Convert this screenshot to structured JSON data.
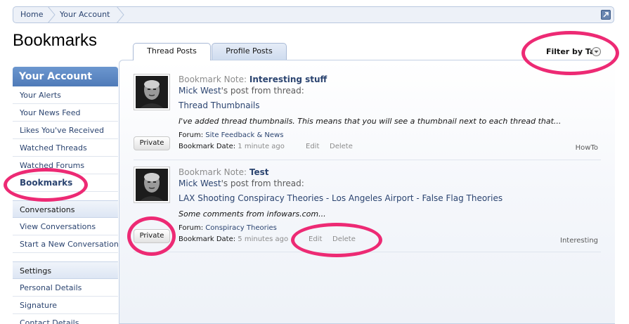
{
  "breadcrumb": {
    "home": "Home",
    "account": "Your Account"
  },
  "page": {
    "title": "Bookmarks"
  },
  "sidebar": {
    "heading": "Your Account",
    "items": [
      {
        "label": "Your Alerts"
      },
      {
        "label": "Your News Feed"
      },
      {
        "label": "Likes You've Received"
      },
      {
        "label": "Watched Threads"
      },
      {
        "label": "Watched Forums"
      },
      {
        "label": "Bookmarks"
      }
    ],
    "conversations": {
      "heading": "Conversations",
      "items": [
        {
          "label": "View Conversations"
        },
        {
          "label": "Start a New Conversation"
        }
      ]
    },
    "settings": {
      "heading": "Settings",
      "items": [
        {
          "label": "Personal Details"
        },
        {
          "label": "Signature"
        },
        {
          "label": "Contact Details"
        }
      ]
    }
  },
  "tabs": [
    {
      "label": "Thread Posts"
    },
    {
      "label": "Profile Posts"
    }
  ],
  "filter": {
    "label": "Filter by Tag"
  },
  "bookmarks": [
    {
      "note_label": "Bookmark Note:",
      "note": "Interesting stuff",
      "user": "Mick West",
      "user_suffix": "'s post from thread:",
      "thread": "Thread Thumbnails",
      "snippet": "I've added thread thumbnails. This means that you will see a thumbnail next to each thread that...",
      "forum_label": "Forum:",
      "forum": "Site Feedback & News",
      "date_label": "Bookmark Date:",
      "date": "1 minute ago",
      "edit": "Edit",
      "delete": "Delete",
      "tag": "HowTo",
      "private": "Private"
    },
    {
      "note_label": "Bookmark Note:",
      "note": "Test",
      "user": "Mick West",
      "user_suffix": "'s post from thread:",
      "thread": "LAX Shooting Conspiracy Theories - Los Angeles Airport - False Flag Theories",
      "snippet": "Some comments from infowars.com...",
      "forum_label": "Forum:",
      "forum": "Conspiracy Theories",
      "date_label": "Bookmark Date:",
      "date": "5 minutes ago",
      "edit": "Edit",
      "delete": "Delete",
      "tag": "Interesting",
      "private": "Private"
    }
  ],
  "colors": {
    "link": "#2b4470",
    "highlight": "#ed2a74",
    "sidebar_head": "#5a86c2"
  },
  "icons": {
    "jump": "external-link-icon",
    "filter": "dropdown-arrow-icon"
  }
}
